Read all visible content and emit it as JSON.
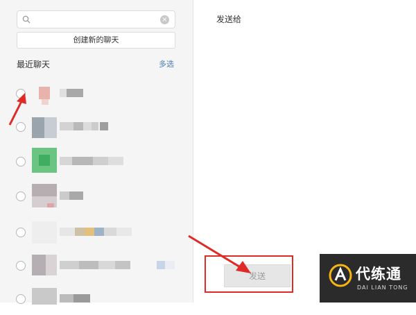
{
  "sidebar": {
    "search": {
      "placeholder": "",
      "value": ""
    },
    "create_chat_label": "创建新的聊天",
    "recent_title": "最近聊天",
    "multi_select_label": "多选",
    "contacts": [
      {
        "name": "",
        "selected": false
      },
      {
        "name": "",
        "selected": false
      },
      {
        "name": "",
        "selected": false
      },
      {
        "name": "",
        "selected": false
      },
      {
        "name": "",
        "selected": false
      },
      {
        "name": "",
        "selected": false
      },
      {
        "name": "",
        "selected": false
      }
    ]
  },
  "main": {
    "send_to_label": "发送给",
    "send_button_label": "发送"
  },
  "watermark": {
    "title": "代练通",
    "subtitle": "DAI LIAN TONG"
  },
  "colors": {
    "annotation_red": "#e02a25",
    "link_blue": "#4a7db5",
    "disabled_button": "#e6e6e6"
  },
  "icons": [
    "search-icon",
    "clear-icon",
    "radio-button",
    "arrow-annotation",
    "logo-icon"
  ]
}
